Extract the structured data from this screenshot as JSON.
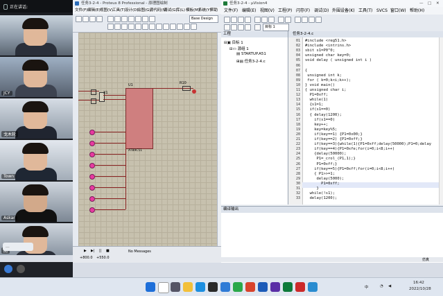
{
  "left_panel": {
    "top_label": "正在讲话:",
    "participants": [
      {
        "name": ""
      },
      {
        "name": "JCY"
      },
      {
        "name": "戈木轮"
      },
      {
        "name": "Town"
      },
      {
        "name": "Askar"
      },
      {
        "name": "高"
      }
    ],
    "chat_label": "..."
  },
  "proteus": {
    "title": "任务3-2-4 - Proteus 8 Professional - 原理图绘制",
    "menu": [
      "文件(F)",
      "编辑(E)",
      "视图(V)",
      "工具(T)",
      "设计(D)",
      "绘图(G)",
      "源代码(S)",
      "调试(G)",
      "库(L)",
      "模板(M)",
      "系统(Y)",
      "帮助(H)"
    ],
    "design_select": "Base Design",
    "chip_label": "U1",
    "chip_part": "AT89C51",
    "crystal_label": "X1",
    "res_label": "R10",
    "status_msg": "No Messages",
    "status_component": "COMPONENT U1, Value=AT89C51, Module=<NONE>, Device=AT89C51",
    "coord_x": "+800.0",
    "coord_y": "+550.0",
    "unit": "th"
  },
  "keil": {
    "title": "任务3-2-4 - µVision4",
    "menu": [
      "文件(F)",
      "编辑(E)",
      "视图(V)",
      "工程(P)",
      "闪存(F)",
      "调试(D)",
      "外围设备(K)",
      "工具(T)",
      "SVCS",
      "窗口(W)",
      "帮助(H)"
    ],
    "project_panel_title": "工程",
    "tree": [
      "目标 1",
      "源组 1",
      "STARTUP.A51",
      "任务3-2-4.c"
    ],
    "tab": "任务3-2-4.c",
    "line_numbers": [
      "01",
      "02",
      "03",
      "04",
      "05",
      "06",
      "07",
      "08",
      "09",
      "10",
      "11",
      "12",
      "13",
      "14",
      "15",
      "16",
      "17",
      "18",
      "19",
      "20",
      "21",
      "22",
      "23",
      "24",
      "25",
      "26",
      "27",
      "28",
      "29",
      "30",
      "31",
      "32",
      "33"
    ],
    "code_lines": [
      "#include <reg51.h>",
      "#include <intrins.h>",
      "sbit s1=P0^0;",
      "unsigned char key=0;",
      "void delay ( unsigned int i )",
      "",
      "{",
      " unsigned int k;",
      " for ( k=0;k<i;k++);",
      "} void main()",
      "{ unsigned char i;",
      "  P1=0xff;",
      "  while(1)",
      "  {s1=1;",
      "  if(s1==0)",
      "  { delay(1200);",
      "    if(s1==0)",
      "    key++;",
      "    key=key%5;",
      "    if(key==1) {P1=0x00;}",
      "    if(key==2) {P1=0xff;}",
      "    if(key==3){while(1){P1=0xff;delay(50000);P1=0;delay",
      "    if(key==4){P1=0xfe;for(i=0;i<8;i++)",
      "    {delay(50000);",
      "     P1=_crol_(P1,1);}",
      "     P1=0xff;}",
      "    if(key==5){P1=0xff;for(i=0;i<8;i++)",
      "    { P1>>=1;",
      "     delay(5000);",
      "       P1=0xff;",
      "     }",
      "  while(!s1);",
      "  delay(1200);"
    ],
    "build_title": "编译输出",
    "status_right": "仿真"
  },
  "taskbar": {
    "time": "16:42",
    "date": "2022/10/28",
    "lang": "中",
    "icons": [
      "windows-icon",
      "search-icon",
      "taskview-icon",
      "explorer-icon",
      "edge-icon",
      "store-icon",
      "mail-icon",
      "app1-icon",
      "app2-icon",
      "app3-icon",
      "app4-icon",
      "app5-icon",
      "app6-icon",
      "app7-icon"
    ]
  }
}
